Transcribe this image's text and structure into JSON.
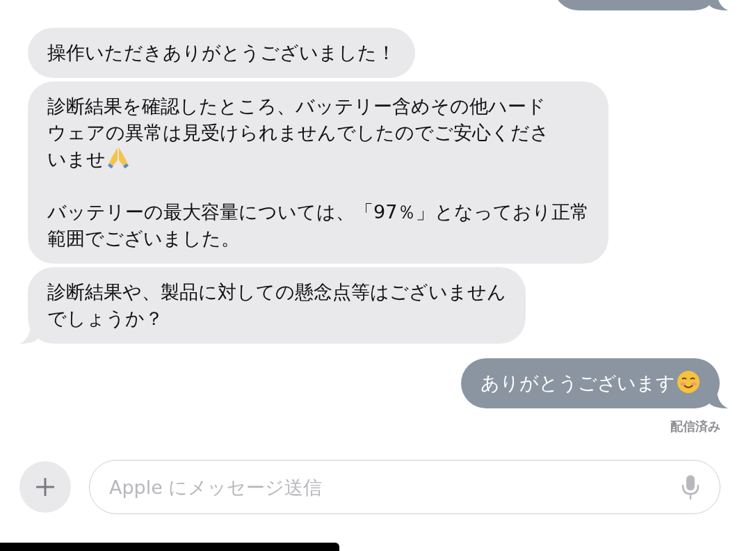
{
  "messages": [
    {
      "kind": "partial",
      "tail": true
    },
    {
      "kind": "incoming",
      "tail": false,
      "paragraphs": [
        {
          "kind": "text",
          "lines": [
            "操作いただきありがとうございました！"
          ]
        }
      ]
    },
    {
      "kind": "incoming",
      "tail": false,
      "paragraphs": [
        {
          "kind": "text_with_icon",
          "lines": [
            "診断結果を確認したところ、バッテリー含めその他ハード",
            "ウェアの異常は見受けられませんでしたのでご安心くださ",
            "いませ"
          ]
        },
        {
          "kind": "text",
          "lines": [
            "バッテリーの最大容量については、「97％」となっており正常",
            "範囲でございました。"
          ]
        }
      ]
    },
    {
      "kind": "incoming",
      "tail": true,
      "paragraphs": [
        {
          "kind": "text",
          "lines": [
            "診断結果や、製品に対しての懸念点等はございません",
            "でしょうか？"
          ]
        }
      ]
    },
    {
      "kind": "outgoing",
      "tail": true,
      "paragraphs": [
        {
          "kind": "text_with_icon",
          "lines": [
            "ありがとうございます"
          ]
        }
      ]
    }
  ],
  "status": "配信済み",
  "composer": {
    "placeholder": "Apple にメッセージ送信"
  }
}
